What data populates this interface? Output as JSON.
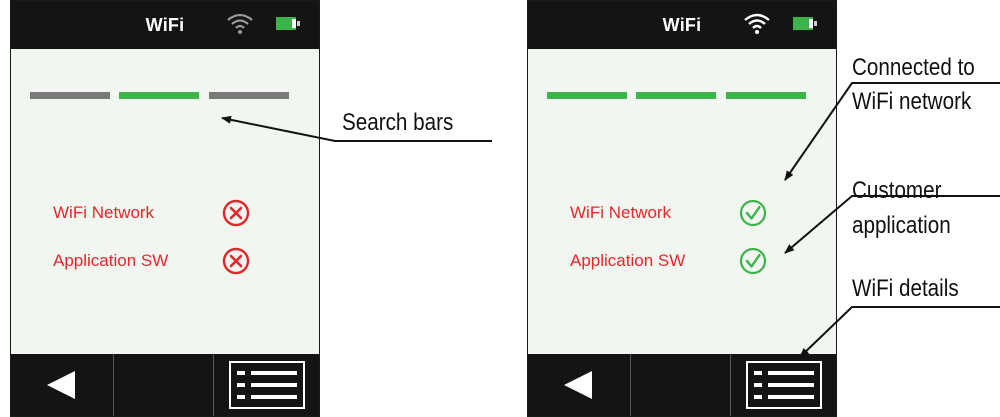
{
  "screens": [
    {
      "id": "left",
      "status_bar": {
        "title": "WiFi"
      },
      "search_bars": [
        "#7a7a7a",
        "#3cb44b",
        "#7a7a7a"
      ],
      "items": [
        {
          "label": "WiFi Network",
          "state": "error-icon"
        },
        {
          "label": "Application SW",
          "state": "error-icon"
        }
      ],
      "nav": [
        "back-icon",
        "",
        "list-icon"
      ]
    },
    {
      "id": "right",
      "status_bar": {
        "title": "WiFi"
      },
      "search_bars": [
        "#3cb44b",
        "#3cb44b",
        "#3cb44b"
      ],
      "items": [
        {
          "label": "WiFi Network",
          "state": "check-icon"
        },
        {
          "label": "Application SW",
          "state": "check-icon"
        }
      ],
      "nav": [
        "back-icon",
        "",
        "list-icon"
      ]
    }
  ],
  "callouts": {
    "search_bars": "Search bars",
    "connected_line1": "Connected to",
    "connected_line2": "WiFi network",
    "customer_line1": "Customer",
    "customer_line2": "application",
    "wifi_details": "WiFi details"
  },
  "colors": {
    "error": "#e8262a",
    "success": "#3cb44b",
    "inactive": "#7a7a7a",
    "header": "#141414",
    "screen_bg": "#f1f6f1"
  }
}
